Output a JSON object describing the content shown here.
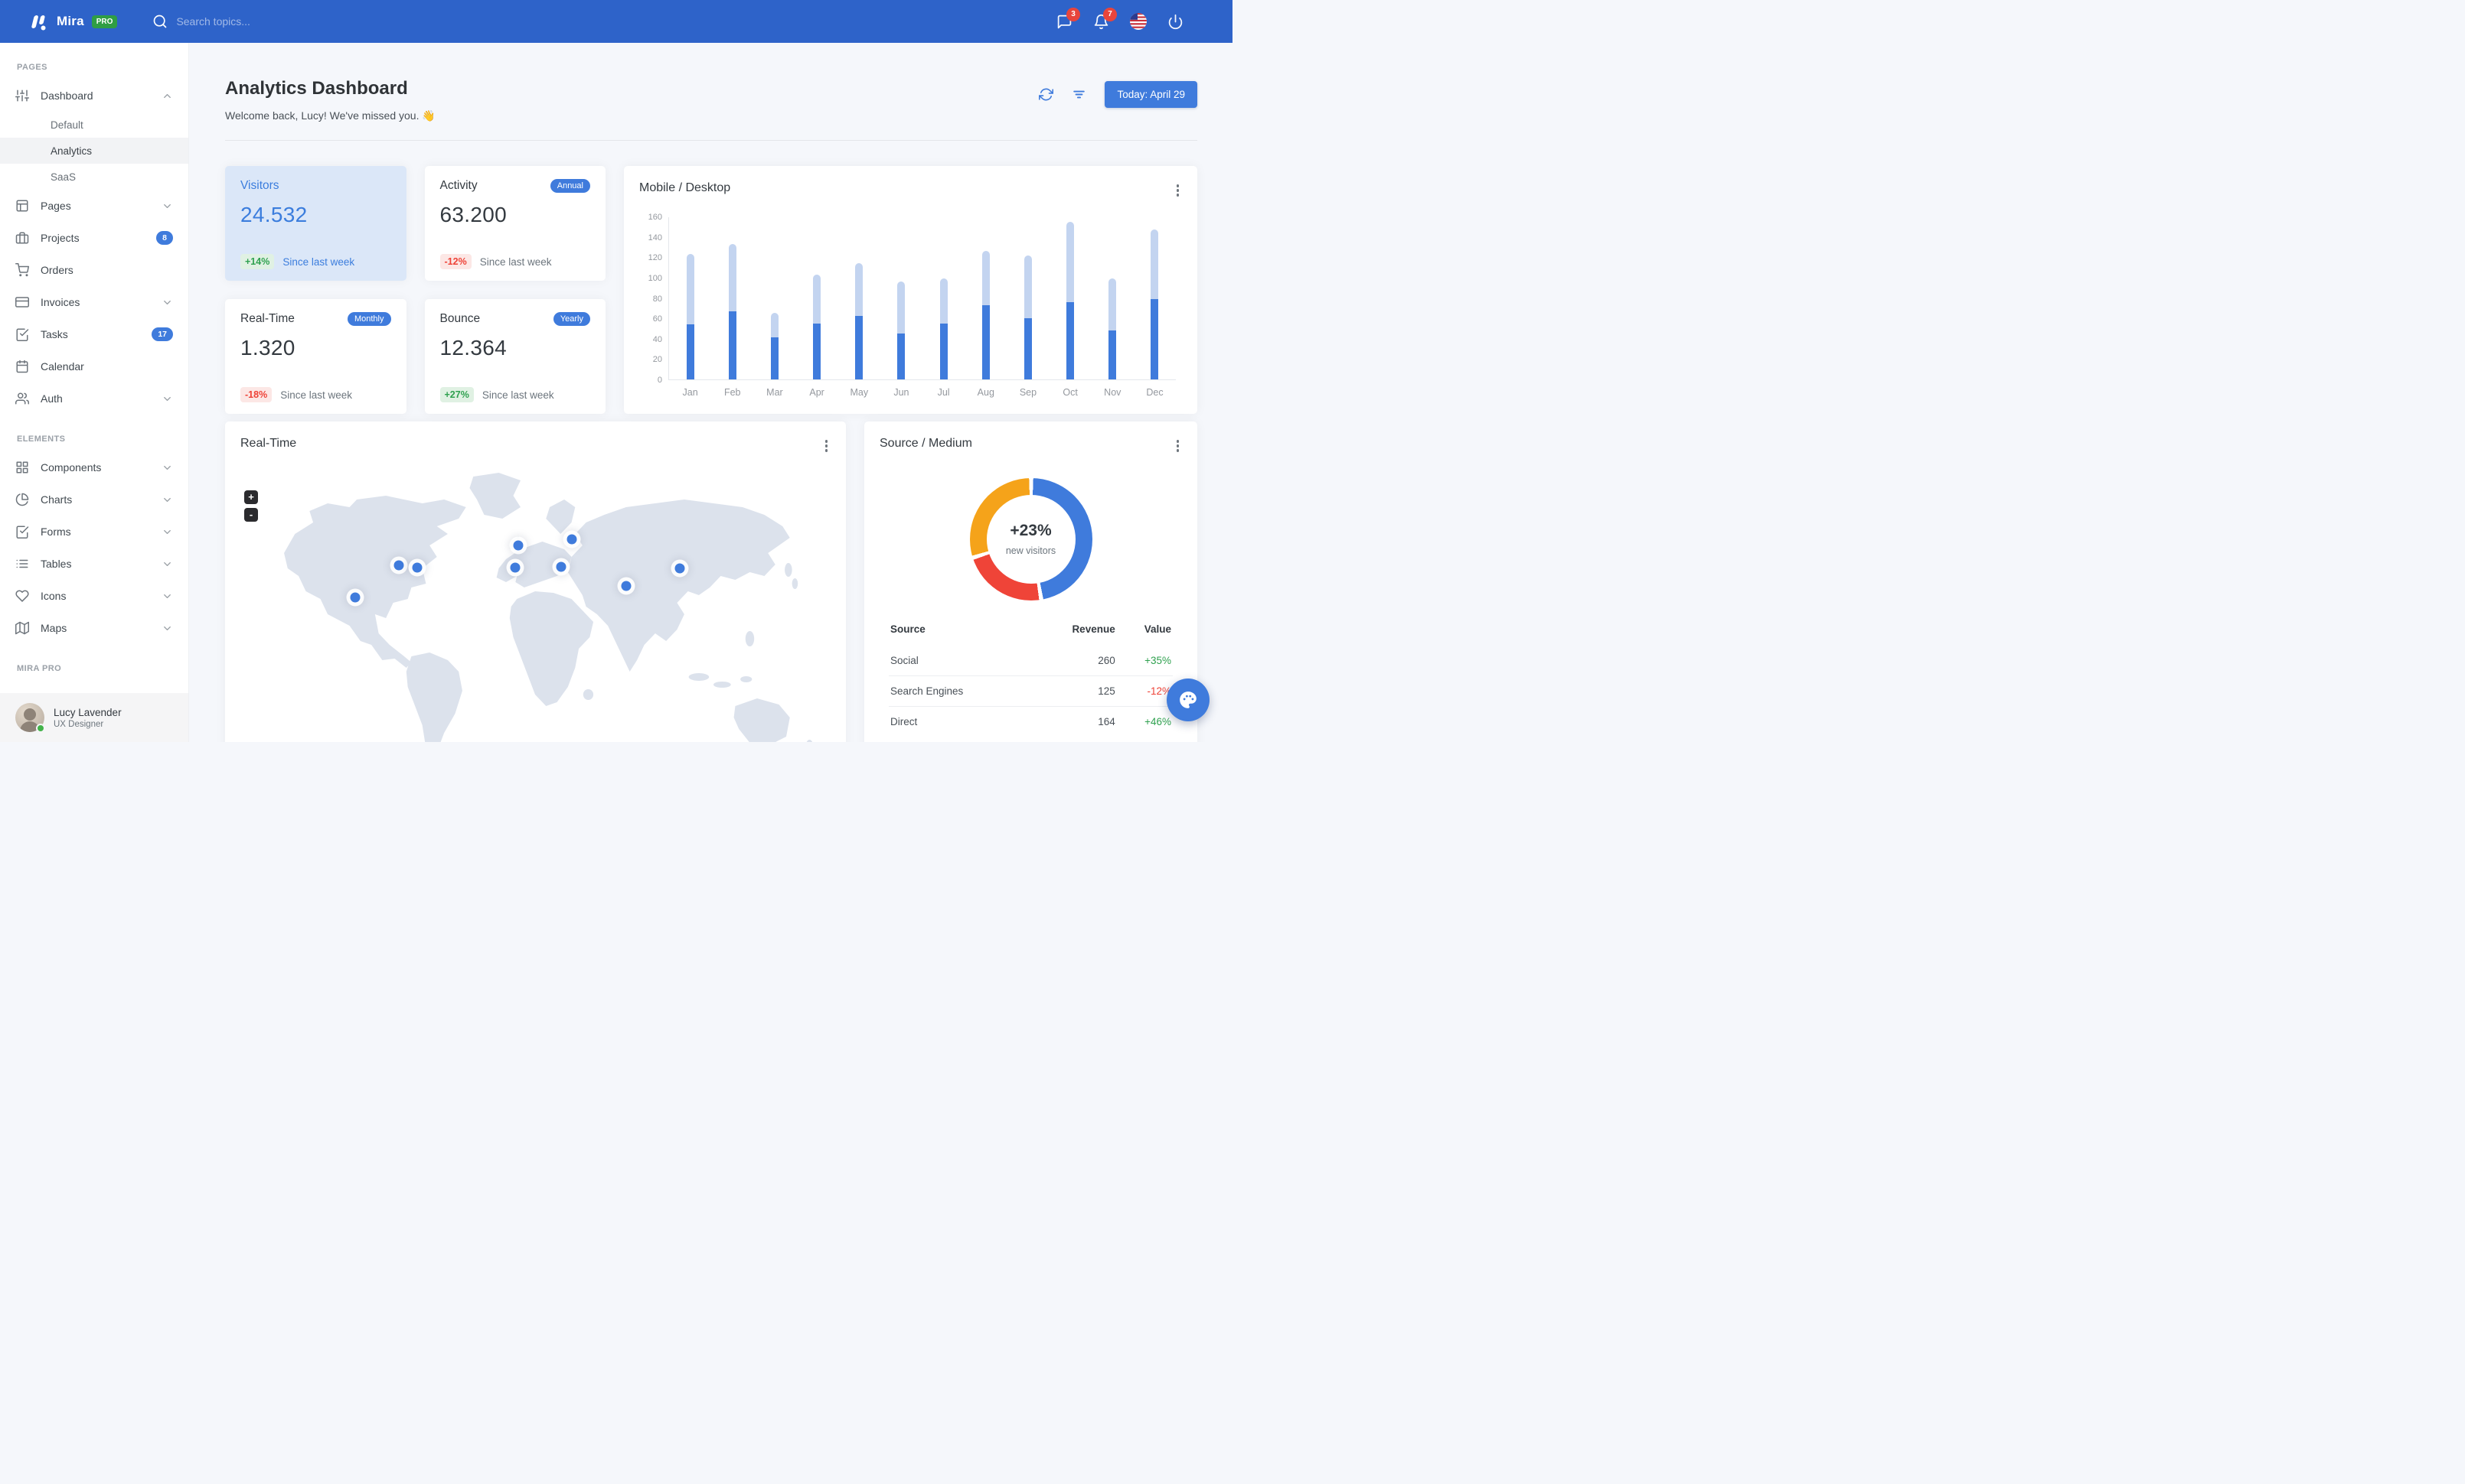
{
  "navbar": {
    "brand": "Mira",
    "brand_badge": "PRO",
    "search_placeholder": "Search topics...",
    "messages_badge": "3",
    "notifications_badge": "7"
  },
  "sidebar": {
    "sections": [
      {
        "label": "PAGES",
        "items": [
          {
            "label": "Dashboard",
            "icon": "sliders-icon",
            "chevron": "up",
            "children": [
              {
                "label": "Default"
              },
              {
                "label": "Analytics",
                "active": true
              },
              {
                "label": "SaaS"
              }
            ]
          },
          {
            "label": "Pages",
            "icon": "layout-icon",
            "chevron": "down"
          },
          {
            "label": "Projects",
            "icon": "briefcase-icon",
            "badge": "8"
          },
          {
            "label": "Orders",
            "icon": "cart-icon"
          },
          {
            "label": "Invoices",
            "icon": "credit-card-icon",
            "chevron": "down"
          },
          {
            "label": "Tasks",
            "icon": "check-square-icon",
            "badge": "17"
          },
          {
            "label": "Calendar",
            "icon": "calendar-icon"
          },
          {
            "label": "Auth",
            "icon": "users-icon",
            "chevron": "down"
          }
        ]
      },
      {
        "label": "ELEMENTS",
        "items": [
          {
            "label": "Components",
            "icon": "grid-icon",
            "chevron": "down"
          },
          {
            "label": "Charts",
            "icon": "pie-chart-icon",
            "chevron": "down"
          },
          {
            "label": "Forms",
            "icon": "check-square-icon",
            "chevron": "down"
          },
          {
            "label": "Tables",
            "icon": "list-icon",
            "chevron": "down"
          },
          {
            "label": "Icons",
            "icon": "heart-icon",
            "chevron": "down"
          },
          {
            "label": "Maps",
            "icon": "map-icon",
            "chevron": "down"
          }
        ]
      },
      {
        "label": "MIRA PRO",
        "items": []
      }
    ],
    "user": {
      "name": "Lucy Lavender",
      "role": "UX Designer"
    }
  },
  "header": {
    "title": "Analytics Dashboard",
    "subtitle": "Welcome back, Lucy! We've missed you. 👋",
    "date_button": "Today: April 29"
  },
  "stats": [
    {
      "title": "Visitors",
      "value": "24.532",
      "delta": "+14%",
      "trend": "up",
      "note": "Since last week",
      "highlight": true
    },
    {
      "title": "Activity",
      "value": "63.200",
      "delta": "-12%",
      "trend": "down",
      "note": "Since last week",
      "chip": "Annual"
    },
    {
      "title": "Real-Time",
      "value": "1.320",
      "delta": "-18%",
      "trend": "down",
      "note": "Since last week",
      "chip": "Monthly"
    },
    {
      "title": "Bounce",
      "value": "12.364",
      "delta": "+27%",
      "trend": "up",
      "note": "Since last week",
      "chip": "Yearly"
    }
  ],
  "chart_data": [
    {
      "type": "bar",
      "title": "Mobile / Desktop",
      "stacked": true,
      "categories": [
        "Jan",
        "Feb",
        "Mar",
        "Apr",
        "May",
        "Jun",
        "Jul",
        "Aug",
        "Sep",
        "Oct",
        "Nov",
        "Dec"
      ],
      "series": [
        {
          "name": "Mobile",
          "color": "#3F7BDC",
          "values": [
            54,
            67,
            41,
            55,
            62,
            45,
            55,
            73,
            60,
            76,
            48,
            79
          ]
        },
        {
          "name": "Desktop",
          "color": "#C3D4F0",
          "values": [
            69,
            66,
            24,
            48,
            52,
            51,
            44,
            53,
            62,
            79,
            51,
            68
          ]
        }
      ],
      "ylim": [
        0,
        160
      ],
      "yticks": [
        0,
        20,
        40,
        60,
        80,
        100,
        120,
        140,
        160
      ],
      "grid": false,
      "legend": "none"
    },
    {
      "type": "pie",
      "title": "Source / Medium",
      "center_label": "+23%",
      "center_sub": "new visitors",
      "slices": [
        {
          "label": "Social",
          "value": 260,
          "color": "#3F7BDC"
        },
        {
          "label": "Search Engines",
          "value": 125,
          "color": "#EF4438"
        },
        {
          "label": "Direct",
          "value": 164,
          "color": "#F5A31A"
        }
      ]
    }
  ],
  "map_card": {
    "title": "Real-Time",
    "zoom_in": "+",
    "zoom_out": "-",
    "markers": [
      {
        "x": 19.5,
        "y": 44.5
      },
      {
        "x": 26.8,
        "y": 34.0
      },
      {
        "x": 30.0,
        "y": 34.8
      },
      {
        "x": 47.1,
        "y": 27.5
      },
      {
        "x": 46.5,
        "y": 34.8
      },
      {
        "x": 56.2,
        "y": 25.5
      },
      {
        "x": 54.3,
        "y": 34.5
      },
      {
        "x": 65.4,
        "y": 40.8
      },
      {
        "x": 74.5,
        "y": 35.0
      }
    ]
  },
  "source_table": {
    "headers": [
      "Source",
      "Revenue",
      "Value"
    ],
    "rows": [
      {
        "source": "Social",
        "revenue": "260",
        "value": "+35%",
        "trend": "up"
      },
      {
        "source": "Search Engines",
        "revenue": "125",
        "value": "-12%",
        "trend": "down"
      },
      {
        "source": "Direct",
        "revenue": "164",
        "value": "+46%",
        "trend": "up"
      }
    ]
  },
  "colors": {
    "navbar": "#2E63C9",
    "primary": "#3F7BDC",
    "success": "#2FA14F",
    "danger": "#EE4237",
    "bar_light": "#C3D4F0",
    "donut_orange": "#F5A31A",
    "donut_red": "#EF4438",
    "highlight_card": "#DBE7F8",
    "background": "#F5F7FB",
    "pro_badge": "#2F9E44",
    "alert_badge": "#E8453C"
  }
}
